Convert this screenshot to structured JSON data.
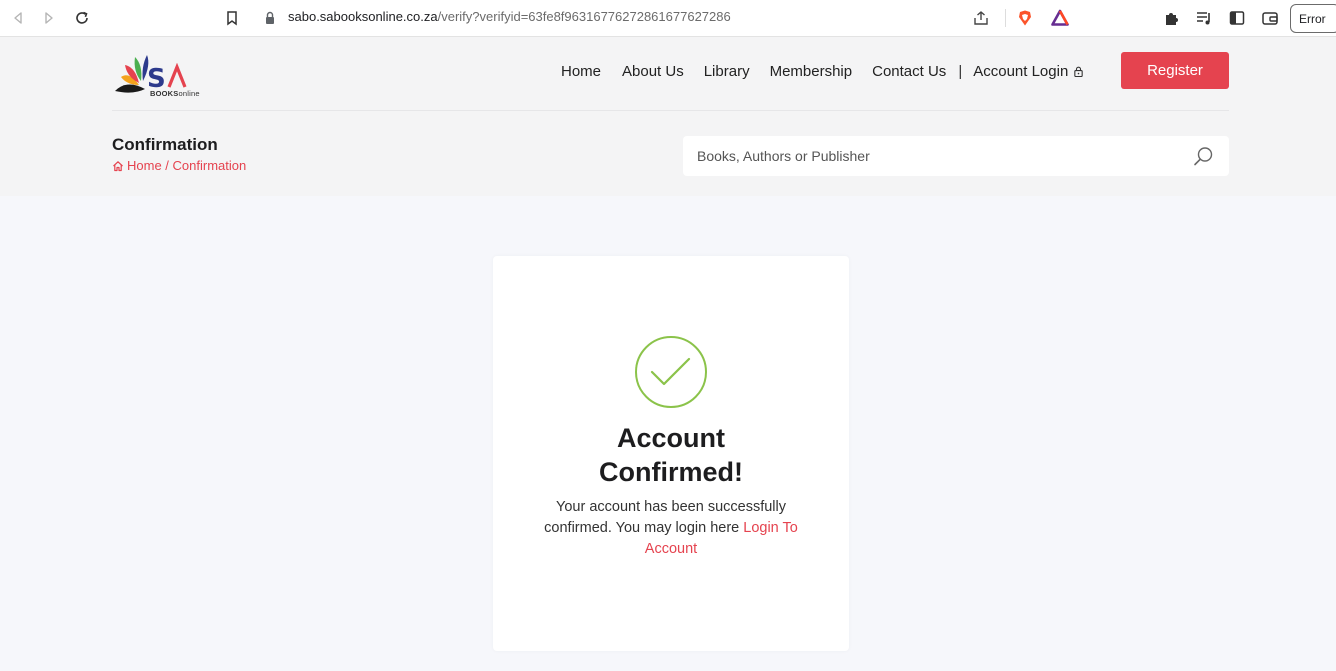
{
  "browser": {
    "url_host": "sabo.sabooksonline.co.za",
    "url_path": "/verify?verifyid=63fe8f9631677627286167762728​6",
    "error_chip": "Error"
  },
  "brand": {
    "logo_mark": "SA",
    "logo_books": "BOOKS",
    "logo_online": "online",
    "accent_color": "#e5434f",
    "success_color": "#8bc34a"
  },
  "nav": {
    "items": [
      {
        "label": "Home"
      },
      {
        "label": "About Us"
      },
      {
        "label": "Library"
      },
      {
        "label": "Membership"
      },
      {
        "label": "Contact Us"
      }
    ],
    "divider": "|",
    "account_login": "Account Login",
    "register": "Register"
  },
  "page": {
    "title": "Confirmation",
    "breadcrumb_home": "Home",
    "breadcrumb_sep": " / ",
    "breadcrumb_current": "Confirmation"
  },
  "search": {
    "placeholder": "Books, Authors or Publisher"
  },
  "card": {
    "title_line1": "Account",
    "title_line2": "Confirmed!",
    "message": "Your account has been successfully confirmed. You may login here ",
    "link_label": "Login To Account"
  }
}
